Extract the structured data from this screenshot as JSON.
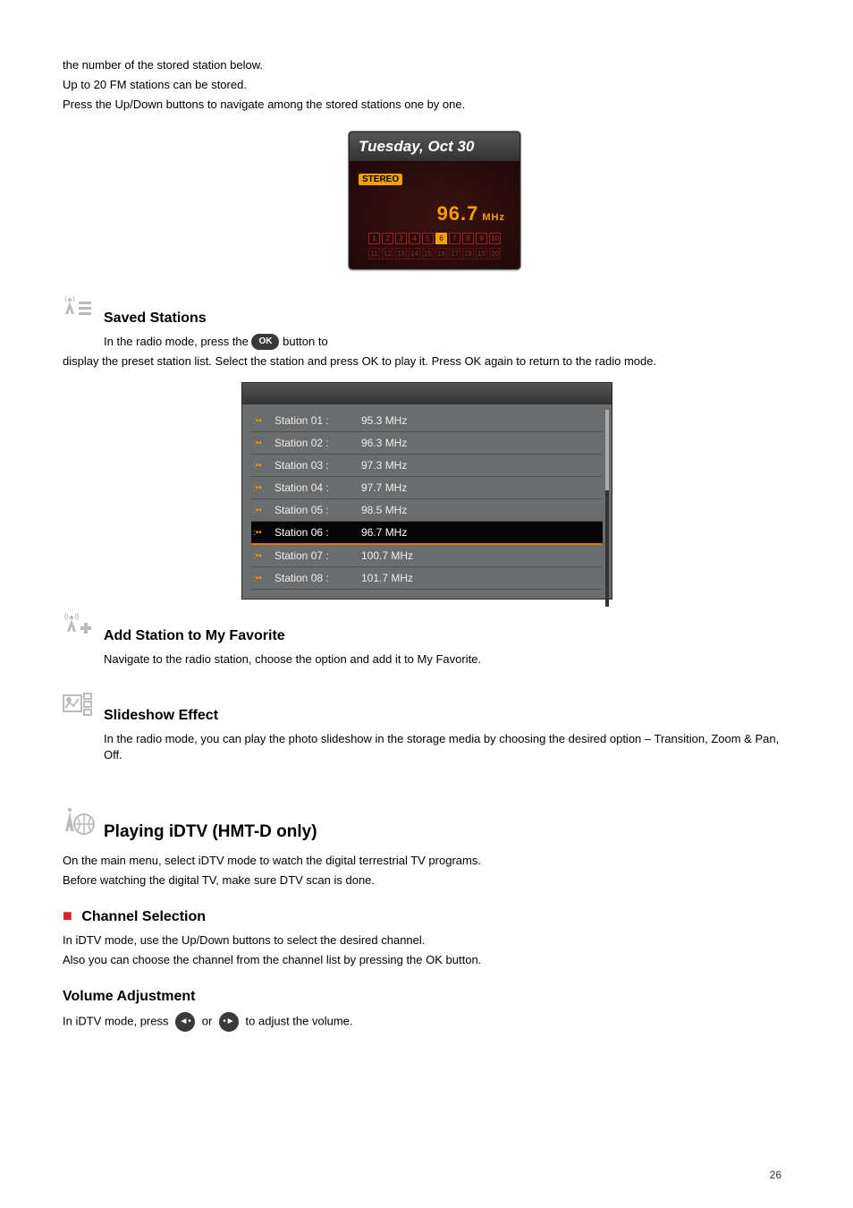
{
  "intro": {
    "line1": "the number of the stored station below.",
    "line2": "Up to 20 FM stations can be stored.",
    "line3": "Press the Up/Down buttons to navigate among the stored stations one by one."
  },
  "radio": {
    "date": "Tuesday, Oct 30",
    "stereo": "STEREO",
    "frequency": "96.7",
    "unit": "MHz",
    "presets_top": [
      "1",
      "2",
      "3",
      "4",
      "5",
      "6",
      "7",
      "8",
      "9",
      "10"
    ],
    "active_preset": "6",
    "presets_bottom": [
      "11",
      "12",
      "13",
      "14",
      "15",
      "16",
      "17",
      "18",
      "19",
      "20"
    ]
  },
  "saved": {
    "heading": "Saved Stations",
    "p1_a": "In the radio mode, press the ",
    "ok_label": "OK",
    "p1_b": " button to",
    "p2": "display the preset station list. Select the station and press OK to play it. Press OK again to return to the radio mode."
  },
  "stations": [
    {
      "name": "Station 01 :",
      "freq": "95.3 MHz"
    },
    {
      "name": "Station 02 :",
      "freq": "96.3 MHz"
    },
    {
      "name": "Station 03 :",
      "freq": "97.3 MHz"
    },
    {
      "name": "Station 04 :",
      "freq": "97.7 MHz"
    },
    {
      "name": "Station 05 :",
      "freq": "98.5 MHz"
    },
    {
      "name": "Station 06 :",
      "freq": "96.7 MHz"
    },
    {
      "name": "Station 07 :",
      "freq": "100.7 MHz"
    },
    {
      "name": "Station 08 :",
      "freq": "101.7 MHz"
    }
  ],
  "selected_station_index": 5,
  "add_station": {
    "heading": "Add Station to My Favorite",
    "text": "Navigate to the radio station, choose the option and add it to My Favorite."
  },
  "slideshow": {
    "heading": "Slideshow Effect",
    "text": "In the radio mode, you can play the photo slideshow in the storage media by choosing the desired option – Transition, Zoom & Pan, Off."
  },
  "dtv": {
    "heading": "Playing iDTV (HMT-D only)",
    "line1": "On the main menu, select iDTV mode to watch the digital terrestrial TV programs.",
    "line2": "Before watching the digital TV, make sure DTV scan is done."
  },
  "channel": {
    "red_marker": "■",
    "heading": "Channel Selection",
    "line1": "In iDTV mode, use the Up/Down buttons to select the desired channel.",
    "line2": "Also you can choose the channel from the channel list by pressing the OK button."
  },
  "volume": {
    "heading": "Volume Adjustment",
    "pre": "In iDTV mode, press ",
    "mid": " or ",
    "post": " to adjust the volume."
  },
  "page": "26"
}
